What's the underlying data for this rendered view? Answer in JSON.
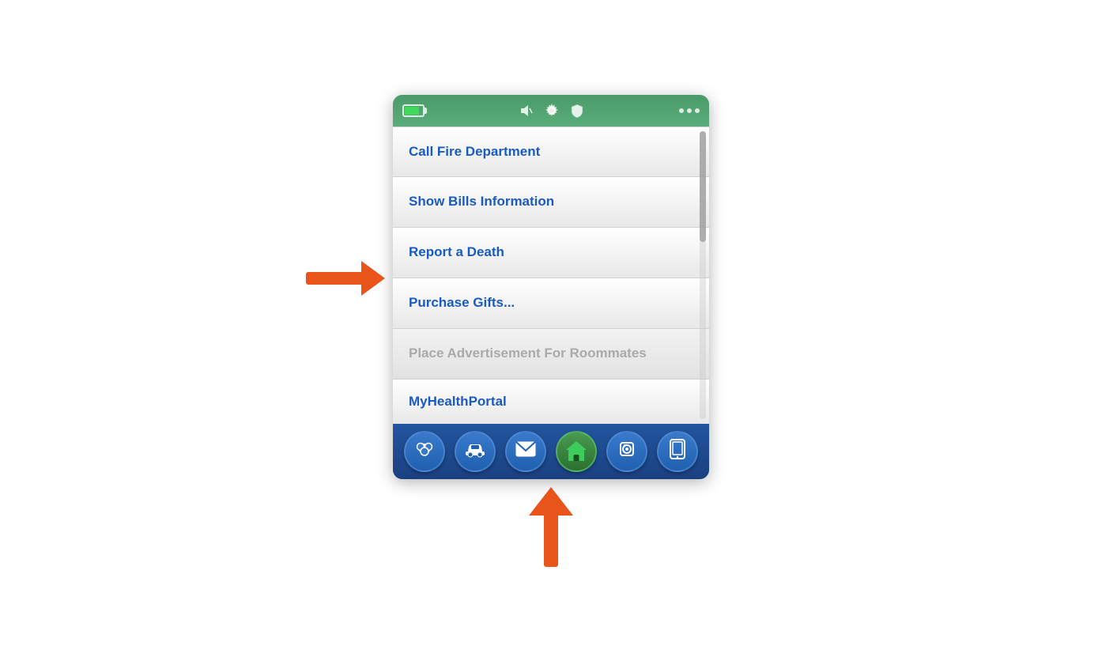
{
  "device": {
    "statusBar": {
      "batteryLabel": "battery",
      "speakerLabel": "speaker",
      "gearLabel": "gear",
      "shieldLabel": "shield",
      "dotsLabel": "signal dots"
    },
    "menu": {
      "items": [
        {
          "id": "call-fire",
          "label": "Call Fire Department",
          "disabled": false
        },
        {
          "id": "show-bills",
          "label": "Show Bills Information",
          "disabled": false
        },
        {
          "id": "report-death",
          "label": "Report a Death",
          "disabled": false
        },
        {
          "id": "purchase-gifts",
          "label": "Purchase Gifts...",
          "disabled": false
        },
        {
          "id": "place-ad",
          "label": "Place Advertisement For Roommates",
          "disabled": true
        },
        {
          "id": "my-health",
          "label": "MyHealthPortal",
          "disabled": false
        }
      ]
    },
    "bottomNav": {
      "items": [
        {
          "id": "social",
          "icon": "social",
          "active": false
        },
        {
          "id": "car",
          "icon": "car",
          "active": false
        },
        {
          "id": "mail",
          "icon": "mail",
          "active": false
        },
        {
          "id": "home",
          "icon": "home",
          "active": true
        },
        {
          "id": "speaker",
          "icon": "speaker",
          "active": false
        },
        {
          "id": "phone",
          "icon": "phone",
          "active": false
        }
      ]
    }
  },
  "arrows": {
    "rightArrow": "points to Report a Death",
    "upArrow": "points to bottom nav home button"
  }
}
